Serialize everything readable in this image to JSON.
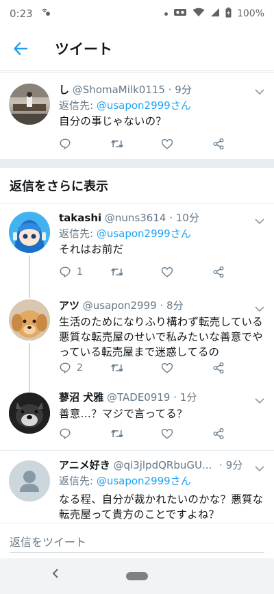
{
  "status_bar": {
    "time": "0:23",
    "battery": "100%"
  },
  "app_bar": {
    "title": "ツイート"
  },
  "colors": {
    "accent": "#1da1f2",
    "text": "#14171a",
    "secondary": "#657786"
  },
  "tweet1": {
    "name": "し",
    "handle": "@ShomaMilk0115",
    "time": "· 9分",
    "reply_prefix": "返信先: ",
    "reply_to": "@usapon2999さん",
    "text": "自分の事じゃないの？"
  },
  "section": {
    "title": "返信をさらに表示"
  },
  "thread": [
    {
      "name": "takashi",
      "handle": "@nuns3614",
      "time": "· 10分",
      "reply_prefix": "返信先: ",
      "reply_to": "@usapon2999さん",
      "text": "それはお前だ",
      "reply_count": "1"
    },
    {
      "name": "アツ",
      "handle": "@usapon2999",
      "time": "· 8分",
      "text": "生活のためになりふり構わず転売している悪質な転売屋のせいで私みたいな善意でやっている転売屋まで迷惑してるの",
      "reply_count": "2"
    },
    {
      "name": "蓼沼 犬雅",
      "handle": "@TADE0919",
      "time": "· 1分",
      "text": "善意…？マジで言ってる？"
    }
  ],
  "tweet5": {
    "name": "アニメ好き",
    "handle": "@qi3jlpdQRbuGU...",
    "time": "· 9分",
    "reply_prefix": "返信先: ",
    "reply_to": "@usapon2999さん",
    "text": "なる程、自分が裁かれたいのかな？悪質な転売屋って貴方のことですよね？"
  },
  "composer": {
    "placeholder": "返信をツイート"
  }
}
